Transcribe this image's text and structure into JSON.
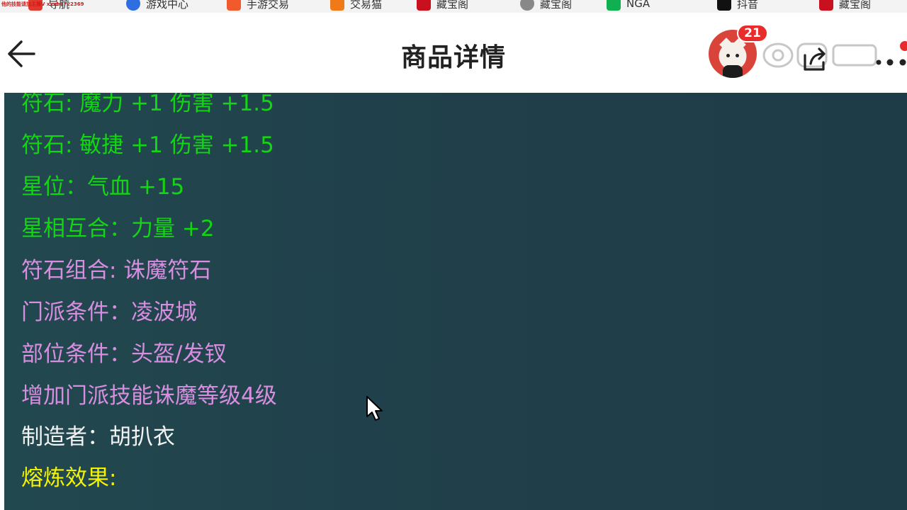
{
  "bookmark_bar": {
    "watermark": "他的技能请加主播V xxxh1722369",
    "items": [
      {
        "label": "导航",
        "color": "#e03a2f"
      },
      {
        "label": "游戏中心",
        "color": "#2f6ee0"
      },
      {
        "label": "手游交易",
        "color": "#f05a2c"
      },
      {
        "label": "交易猫",
        "color": "#f07a1a"
      },
      {
        "label": "藏宝阁",
        "color": "#c8101e"
      },
      {
        "label": "藏宝阁",
        "color": "#888888"
      },
      {
        "label": "NGA",
        "color": "#10b050"
      },
      {
        "label": "抖音",
        "color": "#111111"
      },
      {
        "label": "藏宝阁",
        "color": "#c8101e"
      }
    ]
  },
  "header": {
    "title": "商品详情",
    "badge_count": "21",
    "back_icon": "arrow-left-icon",
    "share_icon": "share-icon",
    "more_icon": "more-dots-icon"
  },
  "item_attributes": [
    {
      "text": "符石: 魔力 +1 伤害 +1.5",
      "color": "green"
    },
    {
      "text": "符石: 敏捷 +1 伤害 +1.5",
      "color": "green"
    },
    {
      "text": "星位：气血 +15",
      "color": "green"
    },
    {
      "text": "星相互合：力量 +2",
      "color": "green"
    },
    {
      "text": "符石组合: 诛魔符石",
      "color": "pink"
    },
    {
      "text": "门派条件：凌波城",
      "color": "pink"
    },
    {
      "text": "部位条件：头盔/发钗",
      "color": "pink"
    },
    {
      "text": "增加门派技能诛魔等级4级",
      "color": "pink"
    },
    {
      "text": "制造者：胡扒衣",
      "color": "white"
    },
    {
      "text": "熔炼效果:",
      "color": "yellow"
    }
  ]
}
